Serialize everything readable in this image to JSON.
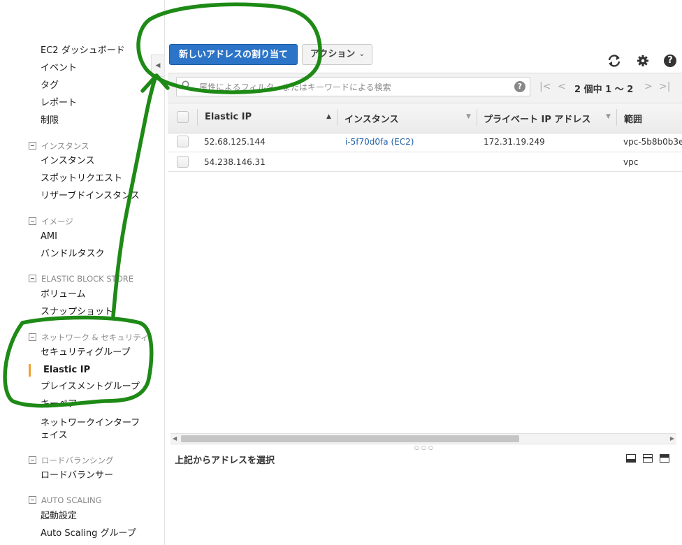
{
  "sidebar": {
    "toggle_label": "◀",
    "top_items": [
      {
        "label": "EC2 ダッシュボード"
      },
      {
        "label": "イベント"
      },
      {
        "label": "タグ"
      },
      {
        "label": "レポート"
      },
      {
        "label": "制限"
      }
    ],
    "sections": [
      {
        "header": "インスタンス",
        "items": [
          "インスタンス",
          "スポットリクエスト",
          "リザーブドインスタンス"
        ]
      },
      {
        "header": "イメージ",
        "items": [
          "AMI",
          "バンドルタスク"
        ]
      },
      {
        "header": "ELASTIC BLOCK STORE",
        "items": [
          "ボリューム",
          "スナップショット"
        ]
      },
      {
        "header": "ネットワーク & セキュリティ",
        "items": [
          "セキュリティグループ",
          "Elastic IP",
          "プレイスメントグループ",
          "キーペア",
          "ネットワークインターフェイス"
        ]
      },
      {
        "header": "ロードバランシング",
        "items": [
          "ロードバランサー"
        ]
      },
      {
        "header": "AUTO SCALING",
        "items": [
          "起動設定",
          "Auto Scaling グループ"
        ]
      }
    ],
    "active_item": "Elastic IP",
    "accent_color": "#f0a030"
  },
  "toolbar": {
    "allocate_button": "新しいアドレスの割り当て",
    "actions_button": "アクション",
    "refresh_icon": "refresh-icon",
    "settings_icon": "gear-icon",
    "help_icon": "help-icon",
    "help_label": "?",
    "primary_color": "#2b74c7"
  },
  "filter": {
    "placeholder": "属性によるフィルタ、またはキーワードによる検索",
    "help_label": "?"
  },
  "pagination": {
    "text": "2 個中 1 ～ 2"
  },
  "table": {
    "columns": [
      "Elastic IP",
      "インスタンス",
      "プライベート IP アドレス",
      "範囲"
    ],
    "rows": [
      {
        "ip": "52.68.125.144",
        "instance": "i-5f70d0fa (EC2)",
        "private_ip": "172.31.19.249",
        "scope": "vpc-5b8b0b3e"
      },
      {
        "ip": "54.238.146.31",
        "instance": "",
        "private_ip": "",
        "scope": "vpc"
      }
    ]
  },
  "details": {
    "title": "上記からアドレスを選択"
  },
  "annotation_color": "#1e8a16"
}
